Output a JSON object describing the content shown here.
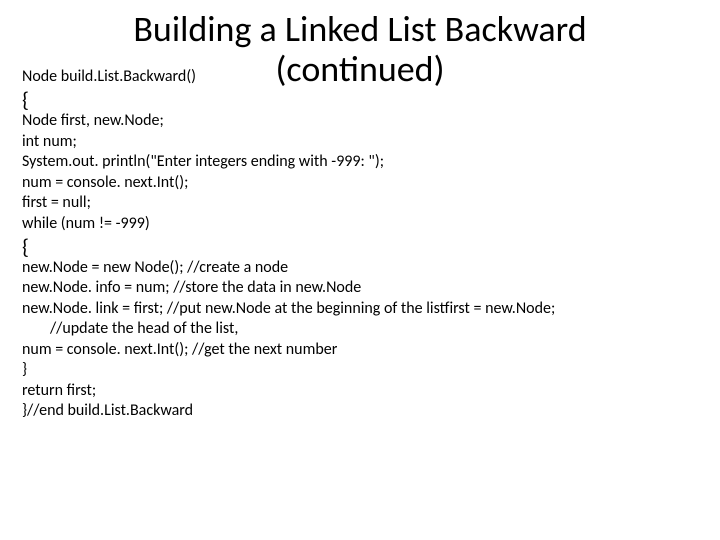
{
  "title_line1": "Building a Linked List Backward",
  "title_line2": "(continued)",
  "sig": "Node build.List.Backward()",
  "brace_open_1": "{",
  "block1": {
    "l1": "Node first, new.Node;",
    "l2": "int num;",
    "l3": "System.out. println(\"Enter integers ending with -999: \");",
    "l4": "num = console. next.Int();",
    "l5": "first = null;",
    "l6": "while (num != -999)"
  },
  "brace_open_2": "{",
  "block2": {
    "l1": "new.Node = new Node(); //create a node",
    "l2": "new.Node. info = num; //store the data in new.Node",
    "l3": "new.Node. link = first; //put new.Node at the beginning of the listfirst = new.Node;",
    "l3b": "//update the head of the list,",
    "l4": "num = console. next.Int(); //get the next number",
    "l5": "}",
    "l6": "return first;",
    "l7": "}//end build.List.Backward"
  }
}
